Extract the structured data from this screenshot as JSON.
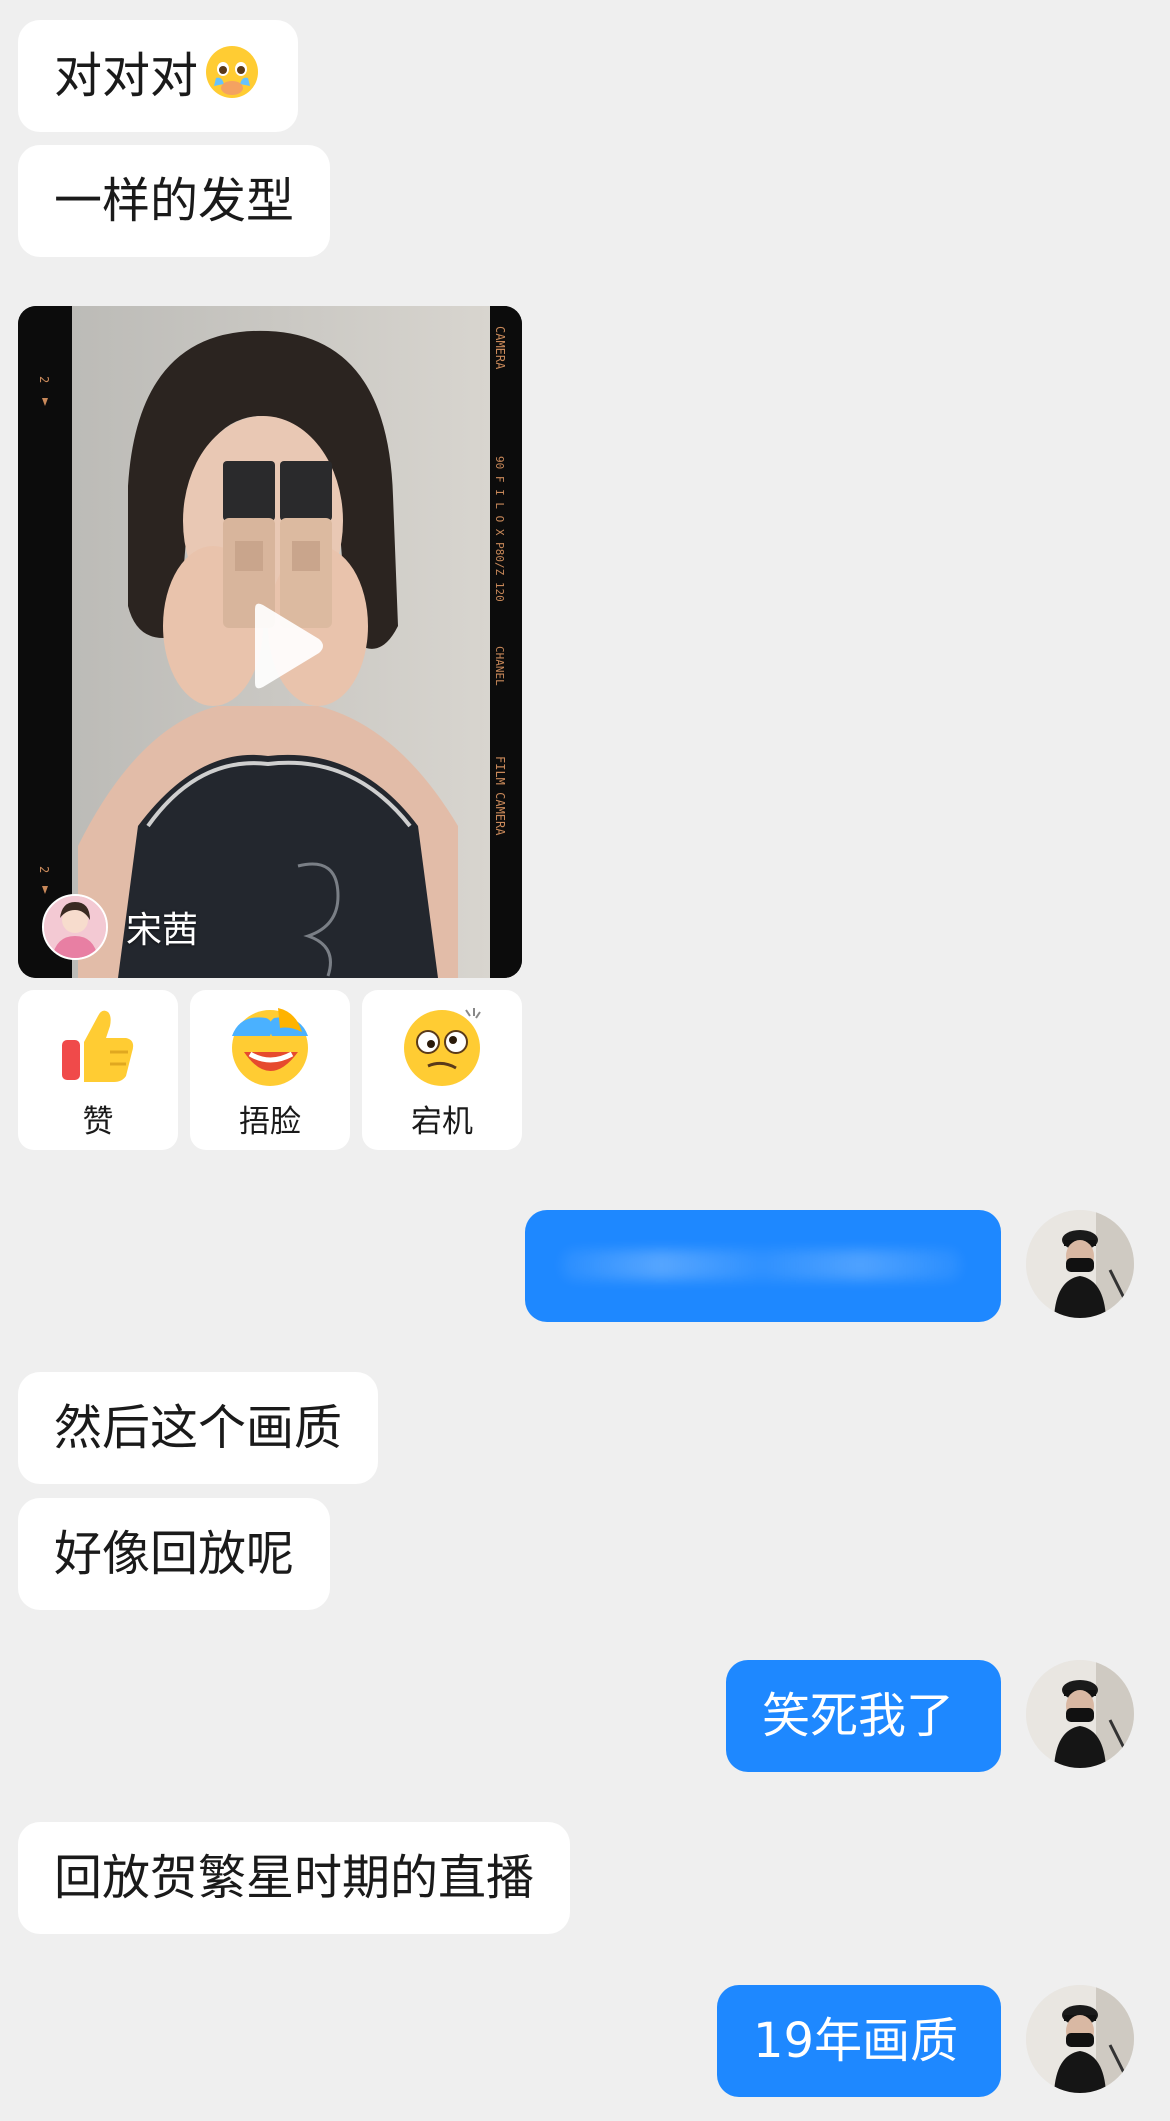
{
  "colors": {
    "background": "#efefef",
    "received_bubble": "#ffffff",
    "sent_bubble": "#1e88ff"
  },
  "messages": [
    {
      "direction": "received",
      "text": "对对对",
      "emoji": "face-holding-back-tears-icon"
    },
    {
      "direction": "received",
      "text": "一样的发型"
    },
    {
      "direction": "received",
      "type": "video",
      "author": "宋茜"
    },
    {
      "direction": "sent",
      "text": ""
    },
    {
      "direction": "received",
      "text": "然后这个画质"
    },
    {
      "direction": "received",
      "text": "好像回放呢"
    },
    {
      "direction": "sent",
      "text": "笑死我了"
    },
    {
      "direction": "received",
      "text": "回放贺繁星时期的直播"
    },
    {
      "direction": "sent",
      "text": "19年画质"
    }
  ],
  "video": {
    "author": "宋茜",
    "film_text": [
      "CAMERA",
      "90 F I L O X P80/Z 120",
      "CHANEL",
      "FILM CAMERA"
    ]
  },
  "reactions": [
    {
      "label": "赞",
      "icon": "thumbs-up-icon"
    },
    {
      "label": "捂脸",
      "icon": "facepalm-icon"
    },
    {
      "label": "宕机",
      "icon": "dizzy-face-icon"
    }
  ]
}
